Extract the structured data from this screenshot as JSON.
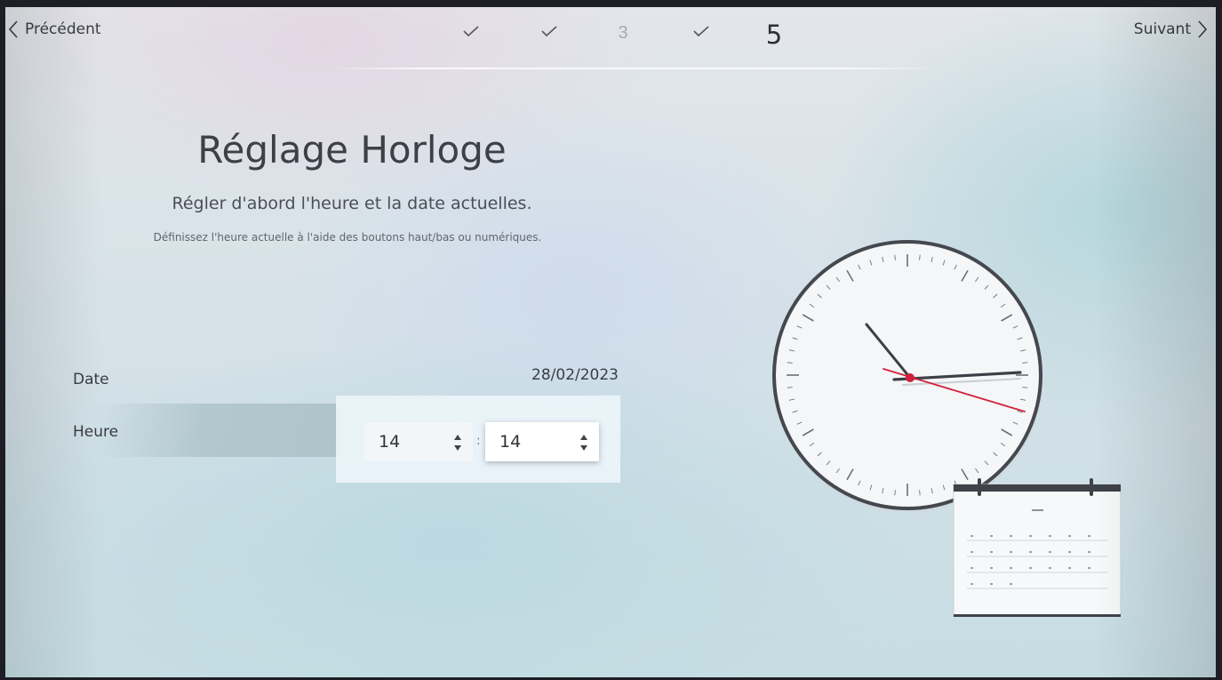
{
  "nav": {
    "prev_label": "Précédent",
    "next_label": "Suivant"
  },
  "steps": [
    {
      "state": "done"
    },
    {
      "state": "done"
    },
    {
      "state": "pending",
      "label": "3"
    },
    {
      "state": "done"
    },
    {
      "state": "current",
      "label": "5"
    }
  ],
  "header": {
    "title": "Réglage Horloge",
    "subtitle": "Régler d'abord l'heure et la date actuelles.",
    "hint": "Définissez l'heure actuelle à l'aide des boutons haut/bas ou numériques."
  },
  "form": {
    "date_label": "Date",
    "date_value": "28/02/2023",
    "time_label": "Heure",
    "hours": "14",
    "minutes": "14",
    "separator": ":"
  },
  "icons": {
    "prev": "chevron-left-icon",
    "next": "chevron-right-icon",
    "step_done": "checkmark-icon",
    "spinner": "up-down-arrows-icon"
  }
}
